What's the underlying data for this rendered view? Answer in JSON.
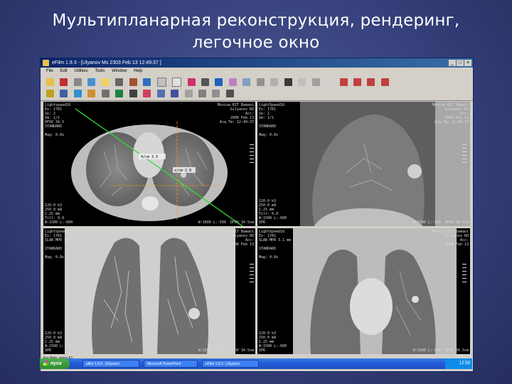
{
  "slide": {
    "title_line1": "Мультипланарная реконструкция, рендеринг,",
    "title_line2": "легочное окно"
  },
  "window": {
    "title": "eFilm 1.9.3 - [Ulyanov Ms 2303 Feb 13 12:49:37 ]",
    "menu": [
      "File",
      "Edit",
      "Utilities",
      "Tools",
      "Window",
      "Help"
    ]
  },
  "viewports": {
    "axial": {
      "top_left": "Lightspeed16\nEx: 1781\nSe: 2\nIm: 1/1\nDFOV 34.5\nSTANDARD\n\nMag: 0.8x",
      "top_right": "Moscow RIT Bamani\nGilyanov RO\nAcc:\n2008 Feb 13\nAcq Tm: 12:49:37",
      "bottom_left": "120.0 kV\n250.0 mA\n1.25 mm\nTilt: 0.0\nW:1500 L:-600",
      "bottom_right": "W:1600 L:-500  DFOV 34.5cm",
      "marker_right": "x/cm 2.8",
      "marker_center": "4/cm 3.5"
    },
    "sagittal": {
      "top_left": "LightSpeed16\nEx: 1781\nSe: 2\nIm: 1/1\n\nSTANDARD\n\nMag: 0.8x",
      "top_right": "Moscow RIT Bamani\nGilyanov RO\nAcc:\n2008 Feb 13\nAcq Tm: 12:49:37",
      "bottom_left": "120.0 kV\n250.0 mA\n1.25 mm\nTilt: 0.0\nW:1500 L:-600\nSPR",
      "bottom_right": "W:1500 L:-500  DFOV 34.5cm"
    },
    "coronal": {
      "top_left": "LightSpeed16\nEx: 1781\nSLAB MPR 3.1 mm\n\nSTANDARD\n\nMag: 0.8x",
      "top_right": "Moscow RIT Bamani\nGilyanov RO\nAcc:\n2008 Feb 13",
      "bottom_left": "120.0 kV\n250.0 mA\n1.25 mm\nW:1500 L:-600\nSPR",
      "bottom_right": "W:1500 L:-500  DFOV 34.5cm"
    },
    "coronal_render": {
      "top_left": "LightSpeed16\nEx: 1781\nSLAB MPR 3.1 mm\n\nSTANDARD\n\nMag: 0.8x",
      "top_right": "Moscow RIT Bamani\nGilyanov RO\nAcc:\n2008 Feb 13",
      "bottom_left": "120.0 kV\n250.0 mA\n1.25 mm\nW:1500 L:-600\nSPR",
      "bottom_right": "W:1500 L:-500  DFOV 34.5cm"
    }
  },
  "status_text": "For Help, press F1",
  "taskbar": {
    "start_label": "пуск",
    "tasks": [
      "efilm 1.9.3 - [Ulyanov",
      "Microsoft PowerPoint",
      "eFilm 1.9.3 - [Ulyanov"
    ],
    "clock": "12:58"
  },
  "colors": {
    "slide_bg": "#36407a",
    "titlebar": "#0a246a",
    "crosshair_green": "#33dd33",
    "crosshair_orange": "#ff9900",
    "taskbar": "#245edb",
    "start_green": "#2e8b2e"
  }
}
